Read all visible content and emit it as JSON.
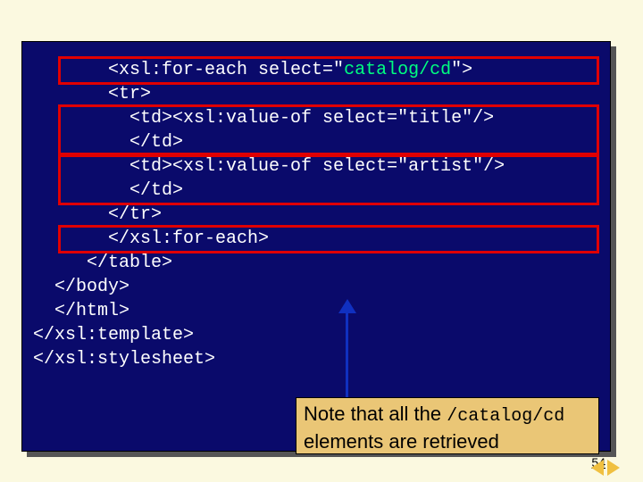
{
  "code": {
    "l1_a": "        <xsl:for-each select=\"",
    "l1_b": "catalog/cd",
    "l1_c": "\">",
    "l2": "        <tr>",
    "l3": "          <td><xsl:value-of select=\"title\"/>",
    "l4": "          </td>",
    "l5": "          <td><xsl:value-of select=\"artist\"/>",
    "l6": "          </td>",
    "l7": "        </tr>",
    "l8": "        </xsl:for-each>",
    "l9": "      </table>",
    "l10": "   </body>",
    "l11": "   </html>",
    "l12": " </xsl:template>",
    "l13": "",
    "l14": " </xsl:stylesheet>"
  },
  "note": {
    "text_a": "Note that all the ",
    "path": "/catalog/cd",
    "text_b": "elements are retrieved"
  },
  "page_number": "54"
}
